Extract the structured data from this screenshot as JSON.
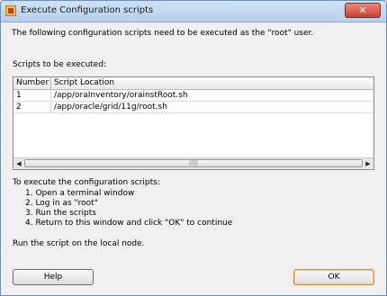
{
  "window": {
    "title": "Execute Configuration scripts",
    "close_label": "✕"
  },
  "intro": "The following configuration scripts need to be executed as the \"root\" user.",
  "scripts_label": "Scripts to be executed:",
  "table": {
    "headers": [
      "Number",
      "Script Location"
    ],
    "rows": [
      [
        "1",
        "/app/oraInventory/orainstRoot.sh"
      ],
      [
        "2",
        "/app/oracle/grid/11g/root.sh"
      ]
    ]
  },
  "scrollbar": {
    "left_arrow": "◀",
    "right_arrow": "▶",
    "grip": "|||||"
  },
  "instructions": {
    "heading": "To execute the configuration scripts:",
    "steps": [
      "1.  Open a terminal window",
      "2.  Log in as \"root\"",
      "3.  Run the scripts",
      "4.  Return to this window and click \"OK\" to continue"
    ]
  },
  "local_note": "Run the script on the local node.",
  "buttons": {
    "help": "Help",
    "ok": "OK"
  }
}
